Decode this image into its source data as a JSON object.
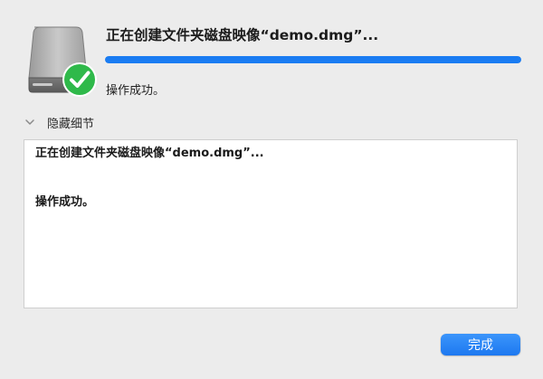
{
  "dialog": {
    "title": "正在创建文件夹磁盘映像“demo.dmg”...",
    "progress_percent": 100,
    "status_text": "操作成功。",
    "icons": {
      "disk": "external-disk-icon",
      "badge": "checkmark-badge-icon",
      "toggle": "chevron-down-icon"
    },
    "colors": {
      "accent": "#1a7cf2",
      "success": "#2fb94a"
    }
  },
  "details": {
    "toggle_label": "隐藏细节",
    "log": [
      "正在创建文件夹磁盘映像“demo.dmg”...",
      "操作成功。"
    ]
  },
  "buttons": {
    "done_label": "完成"
  }
}
